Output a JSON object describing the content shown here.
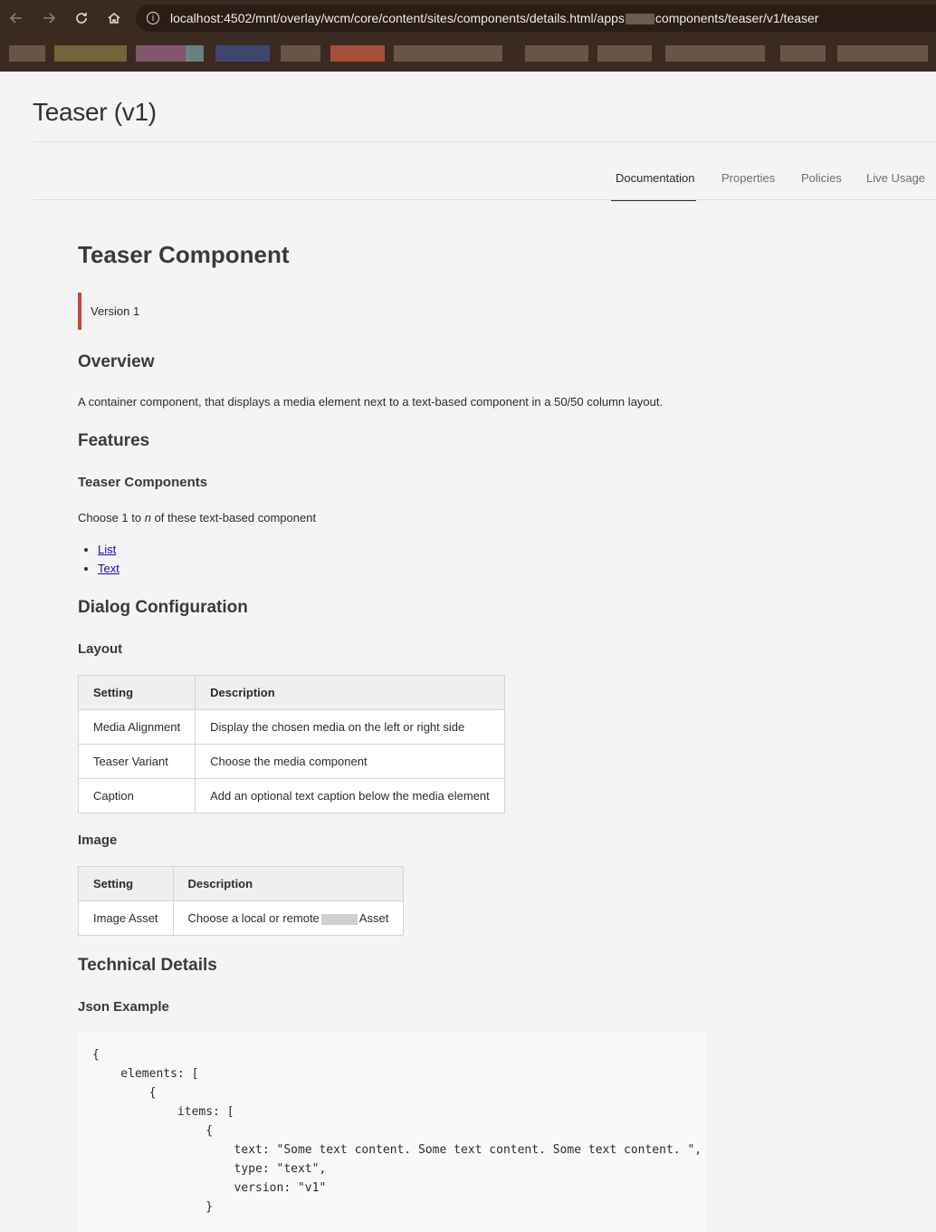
{
  "browser": {
    "url_prefix": "localhost:4502/mnt/overlay/wcm/core/content/sites/components/details.html/apps",
    "url_suffix": "components/teaser/v1/teaser",
    "back_icon": "arrow-left-icon",
    "forward_icon": "arrow-right-icon",
    "reload_icon": "reload-icon",
    "home_icon": "home-icon"
  },
  "header": {
    "title": "Teaser (v1)",
    "tabs": [
      {
        "label": "Documentation",
        "active": true
      },
      {
        "label": "Properties",
        "active": false
      },
      {
        "label": "Policies",
        "active": false
      },
      {
        "label": "Live Usage",
        "active": false
      }
    ]
  },
  "doc": {
    "title": "Teaser Component",
    "version": "Version 1",
    "overview_heading": "Overview",
    "overview_text": "A container component, that displays a media element next to a text-based component in a 50/50 column layout.",
    "features_heading": "Features",
    "teaser_components_heading": "Teaser Components",
    "choose_text_before": "Choose 1 to ",
    "choose_text_n": "n",
    "choose_text_after": " of these text-based component",
    "links": [
      "List",
      "Text"
    ],
    "dialog_heading": "Dialog Configuration",
    "layout_heading": "Layout",
    "layout_table": {
      "headers": [
        "Setting",
        "Description"
      ],
      "rows": [
        [
          "Media Alignment",
          "Display the chosen media on the left or right side"
        ],
        [
          "Teaser Variant",
          "Choose the media component"
        ],
        [
          "Caption",
          "Add an optional text caption below the media element"
        ]
      ]
    },
    "image_heading": "Image",
    "image_table": {
      "headers": [
        "Setting",
        "Description"
      ],
      "rows": [
        [
          "Image Asset",
          "Choose a local or remote",
          "Asset"
        ]
      ]
    },
    "technical_heading": "Technical Details",
    "json_heading": "Json Example",
    "code": "{\n    elements: [\n        {\n            items: [\n                {\n                    text: \"Some text content. Some text content. Some text content. \",\n                    type: \"text\",\n                    version: \"v1\"\n                }"
  },
  "colors": {
    "accent_bar": "#c8463b",
    "link": "#1a0dab",
    "browser_bar": "#3b2a1f"
  }
}
